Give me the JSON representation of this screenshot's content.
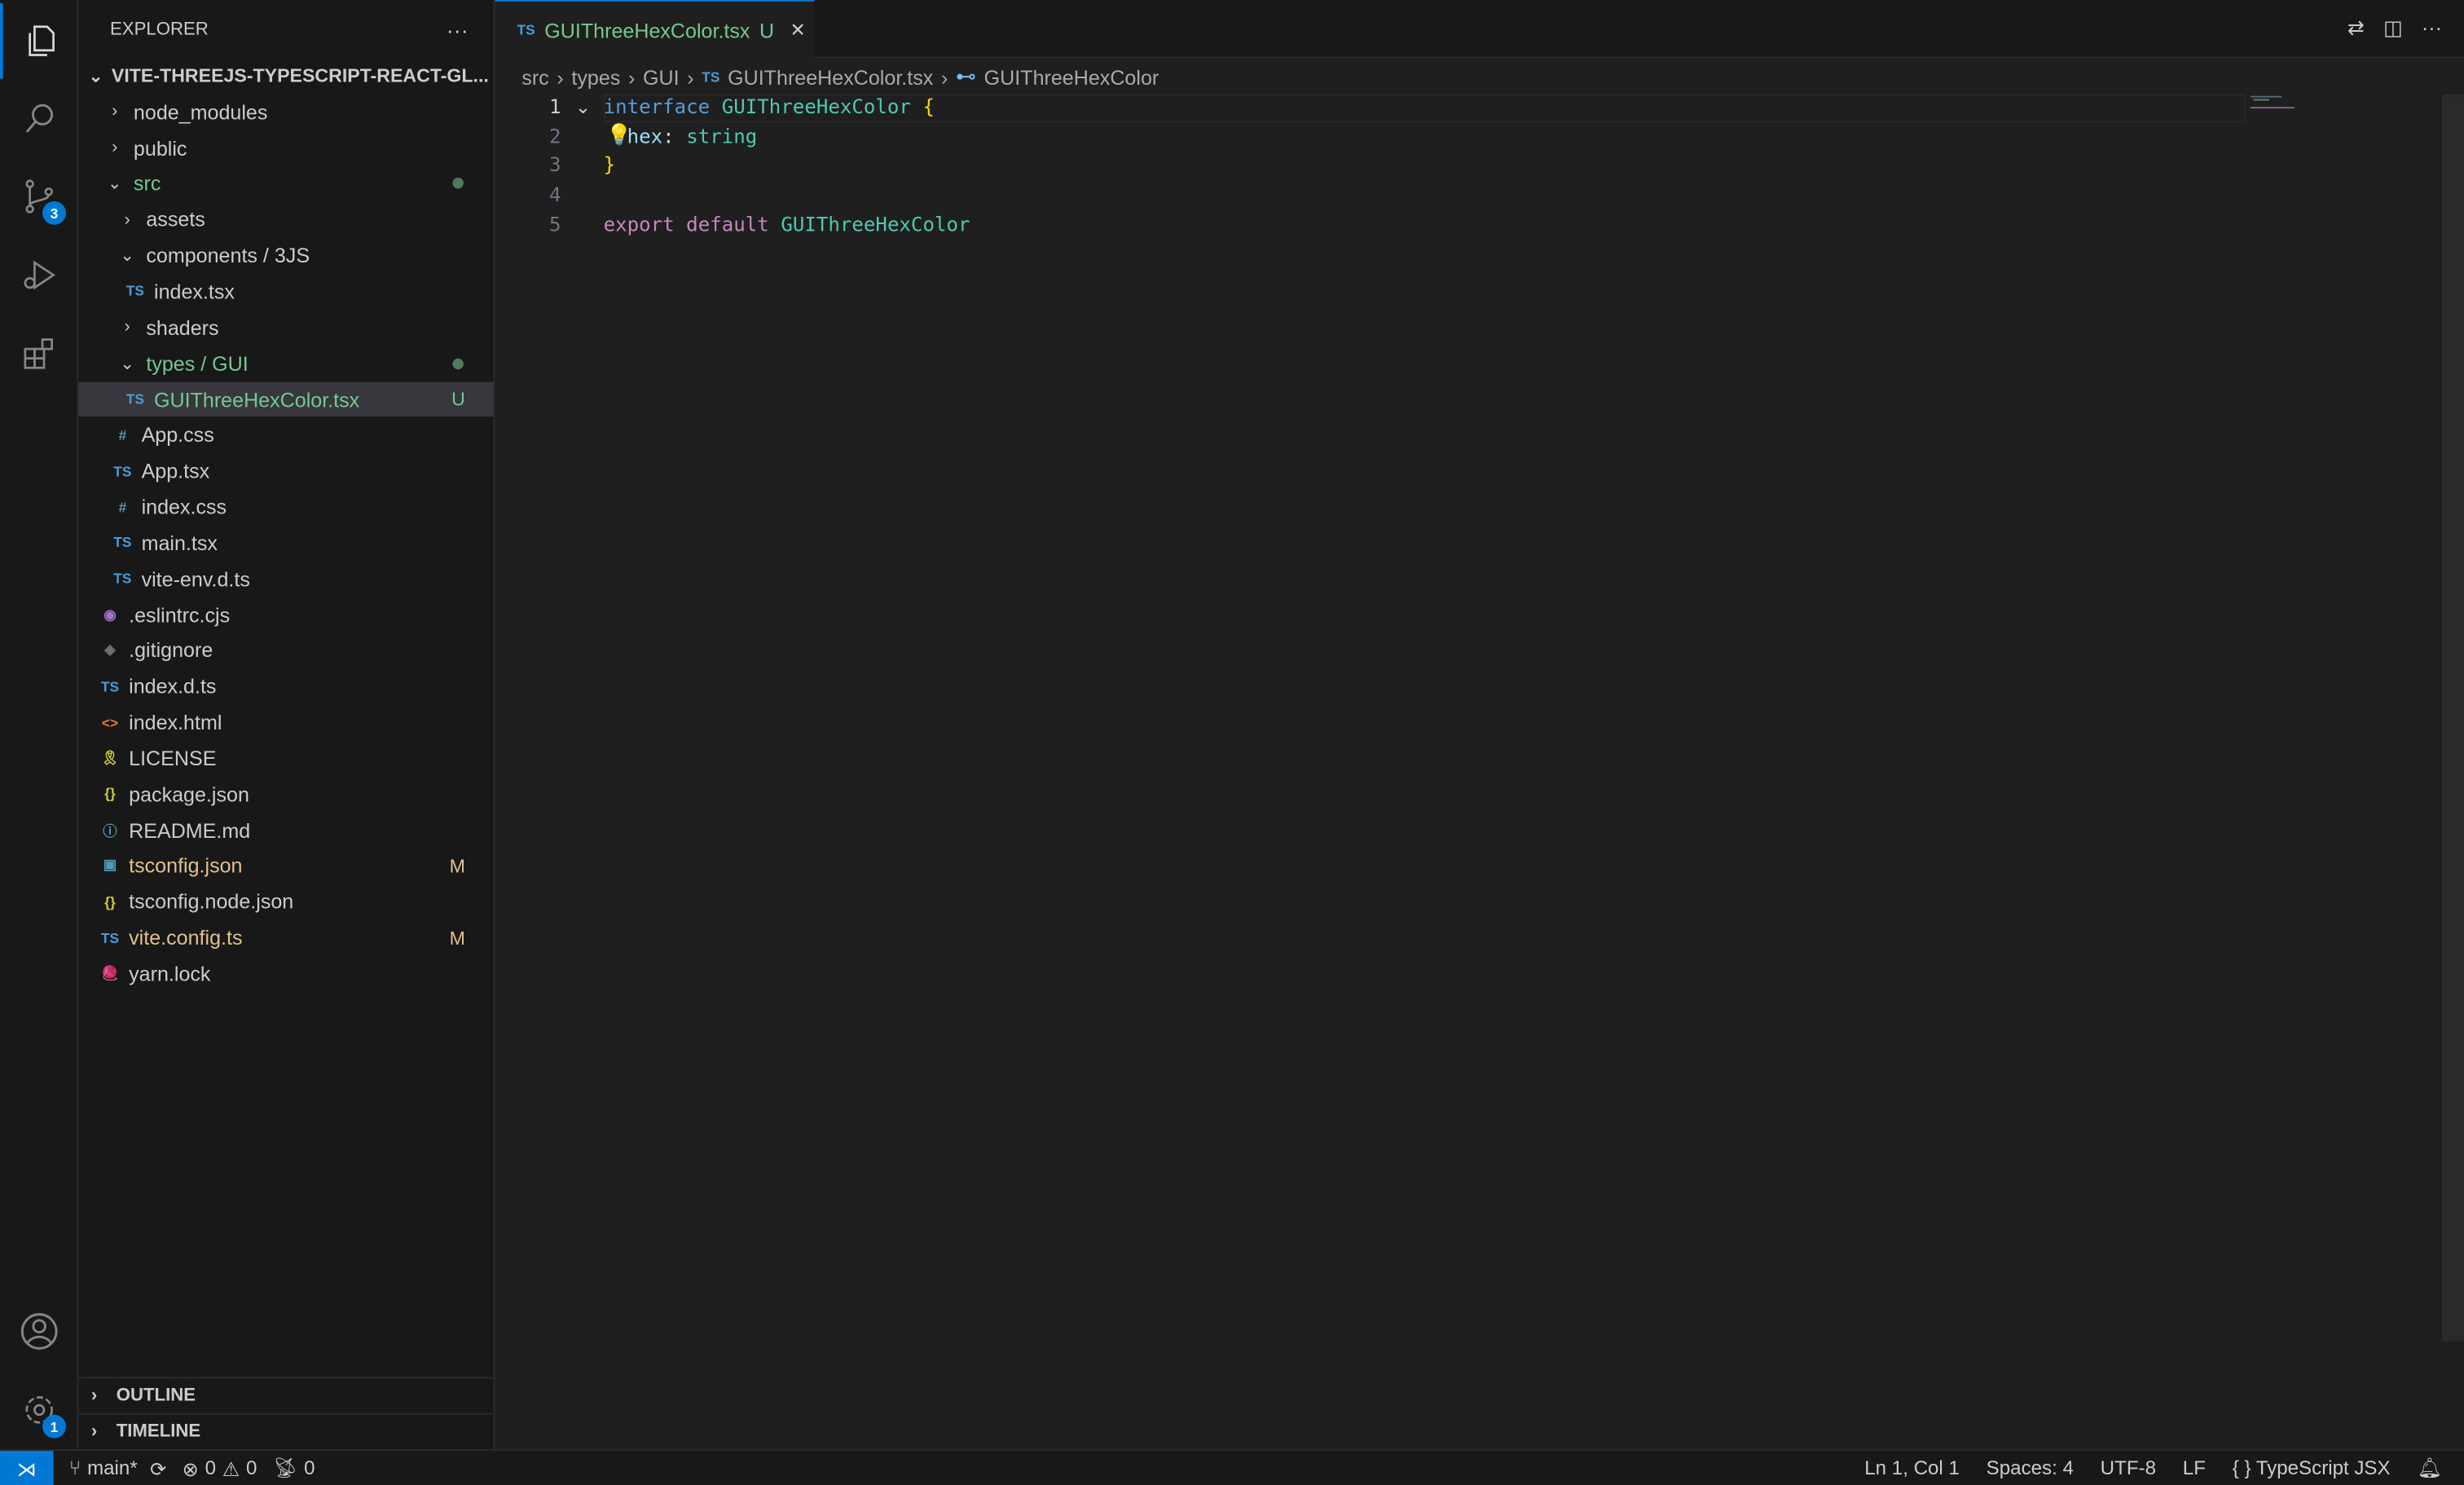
{
  "activity": {
    "items": [
      {
        "icon": "files-icon"
      },
      {
        "icon": "search-icon"
      },
      {
        "icon": "source-control-icon",
        "badge": "3"
      },
      {
        "icon": "run-debug-icon"
      },
      {
        "icon": "extensions-icon"
      }
    ],
    "account_icon": "account-icon",
    "settings": {
      "icon": "gear-icon",
      "badge": "1"
    }
  },
  "sidebar": {
    "title": "EXPLORER",
    "more": "···",
    "root": "VITE-THREEJS-TYPESCRIPT-REACT-GL...",
    "items": [
      {
        "label": "node_modules",
        "type": "folder",
        "open": false,
        "depth": 1
      },
      {
        "label": "public",
        "type": "folder",
        "open": false,
        "depth": 1
      },
      {
        "label": "src",
        "type": "folder",
        "open": true,
        "depth": 1,
        "color": "green",
        "dot": true
      },
      {
        "label": "assets",
        "type": "folder",
        "open": false,
        "depth": 2
      },
      {
        "label": "components / 3JS",
        "type": "folder",
        "open": true,
        "depth": 2
      },
      {
        "label": "index.tsx",
        "type": "ts",
        "depth": 3
      },
      {
        "label": "shaders",
        "type": "folder",
        "open": false,
        "depth": 2
      },
      {
        "label": "types / GUI",
        "type": "folder",
        "open": true,
        "depth": 2,
        "color": "green",
        "dot": true
      },
      {
        "label": "GUIThreeHexColor.tsx",
        "type": "ts",
        "depth": 3,
        "color": "green",
        "status": "U",
        "selected": true
      },
      {
        "label": "App.css",
        "type": "css",
        "depth": 2
      },
      {
        "label": "App.tsx",
        "type": "ts",
        "depth": 2
      },
      {
        "label": "index.css",
        "type": "css",
        "depth": 2
      },
      {
        "label": "main.tsx",
        "type": "ts",
        "depth": 2
      },
      {
        "label": "vite-env.d.ts",
        "type": "ts",
        "depth": 2
      },
      {
        "label": ".eslintrc.cjs",
        "type": "eslint",
        "depth": 1
      },
      {
        "label": ".gitignore",
        "type": "git",
        "depth": 1
      },
      {
        "label": "index.d.ts",
        "type": "ts",
        "depth": 1
      },
      {
        "label": "index.html",
        "type": "html",
        "depth": 1
      },
      {
        "label": "LICENSE",
        "type": "license",
        "depth": 1
      },
      {
        "label": "package.json",
        "type": "json",
        "depth": 1
      },
      {
        "label": "README.md",
        "type": "info",
        "depth": 1
      },
      {
        "label": "tsconfig.json",
        "type": "tsconfig",
        "depth": 1,
        "color": "yellow",
        "status": "M"
      },
      {
        "label": "tsconfig.node.json",
        "type": "json",
        "depth": 1
      },
      {
        "label": "vite.config.ts",
        "type": "ts",
        "depth": 1,
        "color": "yellow",
        "status": "M"
      },
      {
        "label": "yarn.lock",
        "type": "yarn",
        "depth": 1
      }
    ],
    "outline": "OUTLINE",
    "timeline": "TIMELINE"
  },
  "tab": {
    "icon": "TS",
    "label": "GUIThreeHexColor.tsx",
    "status": "U",
    "close": "✕"
  },
  "breadcrumb": [
    "src",
    "types",
    "GUI",
    "GUIThreeHexColor.tsx",
    "GUIThreeHexColor"
  ],
  "breadcrumb_ts": "TS",
  "code": [
    [
      {
        "t": "interface ",
        "c": "#569cd6"
      },
      {
        "t": "GUIThreeHexColor ",
        "c": "#4ec9b0"
      },
      {
        "t": "{",
        "c": "#ffd700"
      }
    ],
    [
      {
        "t": "  hex",
        "c": "#9cdcfe"
      },
      {
        "t": ": ",
        "c": "#d4d4d4"
      },
      {
        "t": "string",
        "c": "#4ec9b0"
      }
    ],
    [
      {
        "t": "}",
        "c": "#ffd700"
      }
    ],
    [],
    [
      {
        "t": "export ",
        "c": "#c586c0"
      },
      {
        "t": "default ",
        "c": "#c586c0"
      },
      {
        "t": "GUIThreeHexColor",
        "c": "#4ec9b0"
      }
    ]
  ],
  "line_numbers": [
    "1",
    "2",
    "3",
    "4",
    "5"
  ],
  "status": {
    "branch": "main*",
    "errors": "0",
    "warnings": "0",
    "ports": "0",
    "position": "Ln 1, Col 1",
    "spaces": "Spaces: 4",
    "encoding": "UTF-8",
    "eol": "LF",
    "language": "TypeScript JSX"
  },
  "colors": {
    "accent": "#0078d4",
    "untracked": "#73c991",
    "modified": "#e2c08d"
  }
}
